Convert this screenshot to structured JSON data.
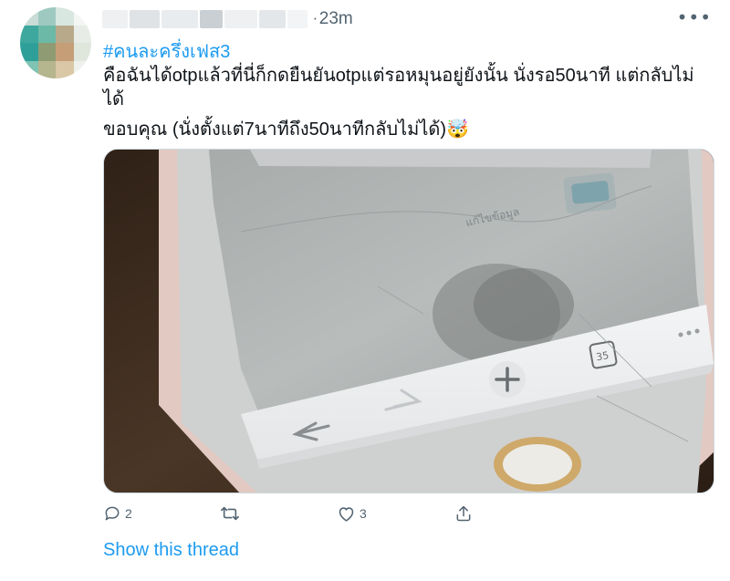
{
  "tweet": {
    "timestamp": "23m",
    "separator": "·",
    "more_label": "•••",
    "hashtag": "#คนละครึ่งเฟส3",
    "text_line1": "คือฉันได้otpแล้วที่นี่ก็กดยืนยันotpแต่รอหมุนอยู่ยังนั้น นั่งรอ50นาที แต่กลับไม่ได้",
    "text_line2": "ขอบคุณ (นั่งตั้งแต่7นาทีถึง50นาทีกลับไม่ได้)🤯",
    "image_tab_count": "35",
    "reply_count": "2",
    "like_count": "3",
    "show_thread": "Show this thread"
  },
  "colors": {
    "accent": "#1d9bf0",
    "secondary_text": "#536471",
    "primary_text": "#0f1419"
  },
  "icons": {
    "more": "ellipsis-icon",
    "reply": "speech-bubble-icon",
    "retweet": "retweet-icon",
    "like": "heart-icon",
    "share": "share-upload-icon"
  }
}
